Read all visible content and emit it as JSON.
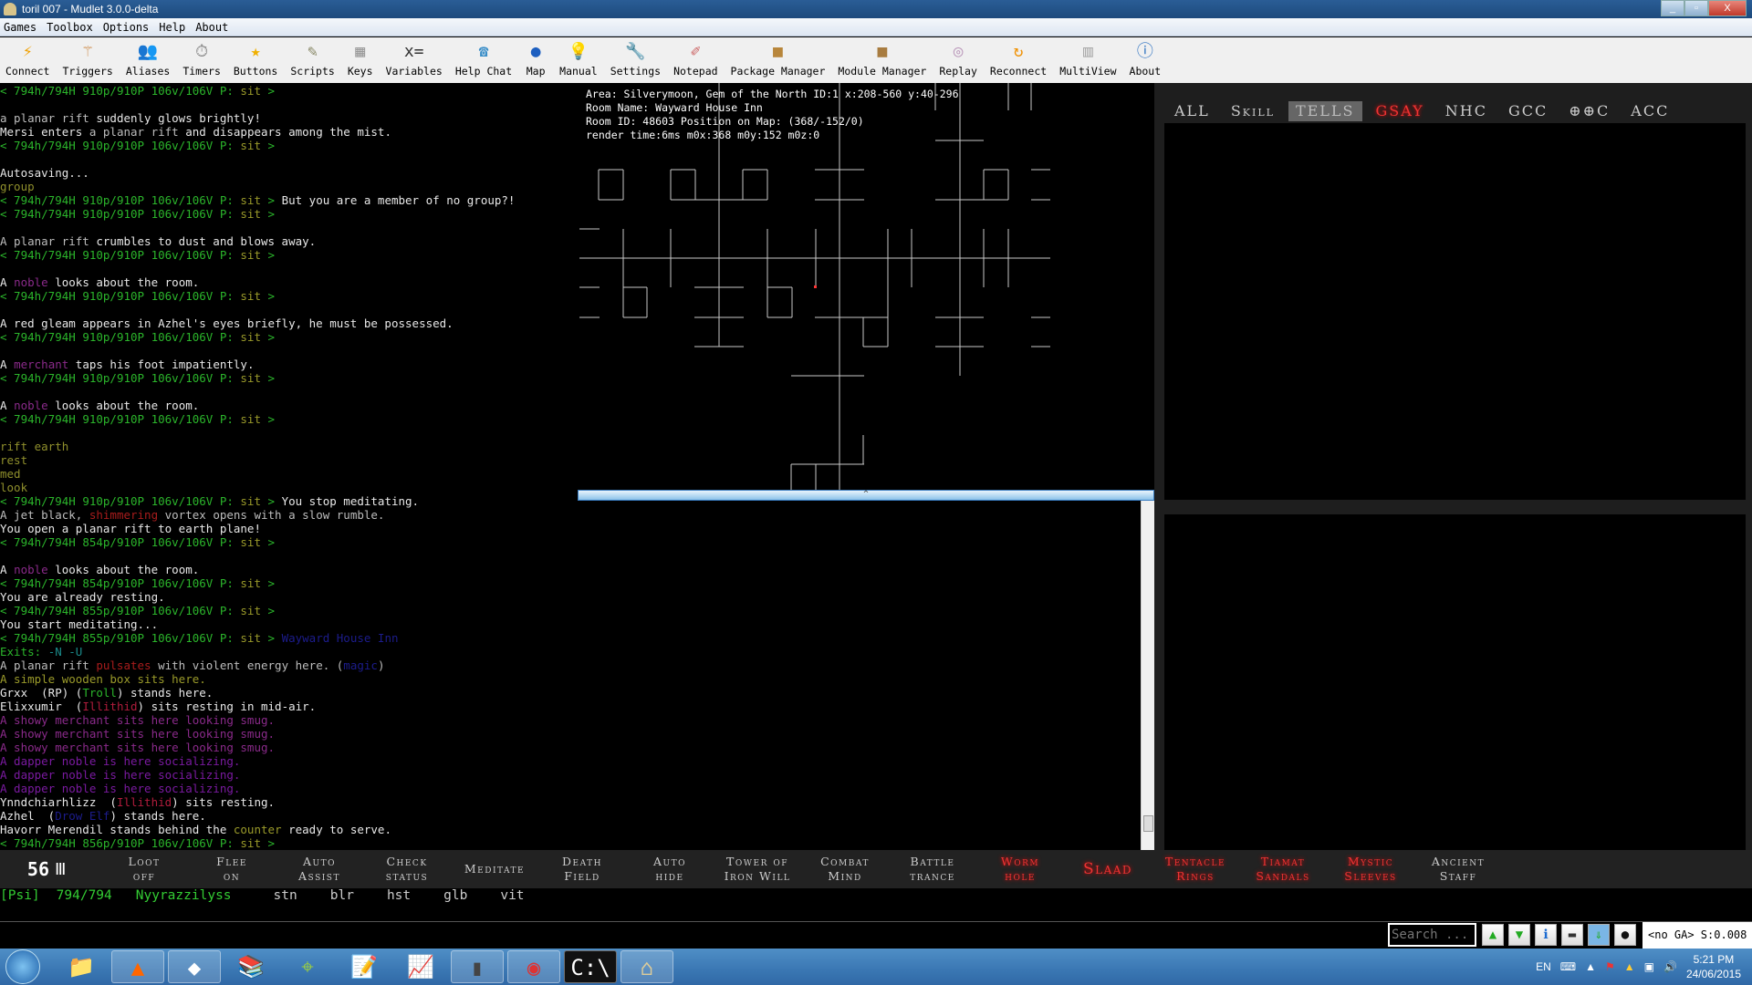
{
  "window": {
    "title": "toril 007 - Mudlet 3.0.0-delta"
  },
  "menu": [
    "Games",
    "Toolbox",
    "Options",
    "Help",
    "About"
  ],
  "toolbar": [
    {
      "label": "Connect",
      "icon": "connect-icon",
      "glyph": "⚡",
      "color": "#f0a000"
    },
    {
      "label": "Triggers",
      "icon": "triggers-icon",
      "glyph": "⚚",
      "color": "#c84"
    },
    {
      "label": "Aliases",
      "icon": "aliases-icon",
      "glyph": "👥",
      "color": "#a86"
    },
    {
      "label": "Timers",
      "icon": "timers-icon",
      "glyph": "⏱",
      "color": "#888"
    },
    {
      "label": "Buttons",
      "icon": "buttons-icon",
      "glyph": "★",
      "color": "#f0b000"
    },
    {
      "label": "Scripts",
      "icon": "scripts-icon",
      "glyph": "✎",
      "color": "#886"
    },
    {
      "label": "Keys",
      "icon": "keys-icon",
      "glyph": "▦",
      "color": "#999"
    },
    {
      "label": "Variables",
      "icon": "variables-icon",
      "glyph": "x=",
      "color": "#333"
    },
    {
      "label": "Help Chat",
      "icon": "help-chat-icon",
      "glyph": "☎",
      "color": "#3a8ec8"
    },
    {
      "label": "Map",
      "icon": "map-icon",
      "glyph": "●",
      "color": "#1d5fc0"
    },
    {
      "label": "Manual",
      "icon": "manual-icon",
      "glyph": "💡",
      "color": "#eec000"
    },
    {
      "label": "Settings",
      "icon": "settings-icon",
      "glyph": "🔧",
      "color": "#999"
    },
    {
      "label": "Notepad",
      "icon": "notepad-icon",
      "glyph": "✐",
      "color": "#c66"
    },
    {
      "label": "Package Manager",
      "icon": "package-manager-icon",
      "glyph": "■",
      "color": "#b8863b"
    },
    {
      "label": "Module Manager",
      "icon": "module-manager-icon",
      "glyph": "■",
      "color": "#a87c40"
    },
    {
      "label": "Replay",
      "icon": "replay-icon",
      "glyph": "◎",
      "color": "#b9b"
    },
    {
      "label": "Reconnect",
      "icon": "reconnect-icon",
      "glyph": "↻",
      "color": "#f09000"
    },
    {
      "label": "MultiView",
      "icon": "multiview-icon",
      "glyph": "▥",
      "color": "#aaa"
    },
    {
      "label": "About",
      "icon": "about-icon",
      "glyph": "ⓘ",
      "color": "#2a70c0"
    }
  ],
  "colors": {
    "prompt": "#2bb52b",
    "sit": "#9a9a2a",
    "gray": "#bdbdbd",
    "white": "#e8e8e8",
    "cmd": "#8f8f2c",
    "purple": "#8a2a8a",
    "red": "#a81c1c",
    "blue": "#1c1c8c",
    "teal": "#1a8a8a",
    "crimson": "#b01c3c",
    "violet": "#7a1aa0",
    "olive": "#9a9a2a"
  },
  "prompt": {
    "pre": "< 794h/794H ",
    "mid": " 106v/106V P: ",
    "sit": "sit",
    " end": " >",
    "end": " >"
  },
  "console": [
    {
      "p": "910p/910P",
      "s": []
    },
    {
      "s": []
    },
    {
      "s": [
        [
          "a planar rift",
          "gray"
        ],
        [
          " suddenly glows brightly!",
          "white"
        ]
      ]
    },
    {
      "s": [
        [
          "Mersi enters ",
          "white"
        ],
        [
          "a planar rift",
          "gray"
        ],
        [
          " and disappears among the mist.",
          "white"
        ]
      ]
    },
    {
      "p": "910p/910P",
      "s": []
    },
    {
      "s": []
    },
    {
      "s": [
        [
          "Autosaving...",
          "white"
        ]
      ]
    },
    {
      "s": [
        [
          "group",
          "cmd"
        ]
      ]
    },
    {
      "p": "910p/910P",
      "s": [
        [
          " But you are a member of no group?!",
          "white"
        ]
      ]
    },
    {
      "p": "910p/910P",
      "s": []
    },
    {
      "s": []
    },
    {
      "s": [
        [
          "A planar rift",
          "gray"
        ],
        [
          " crumbles to dust and blows away.",
          "white"
        ]
      ]
    },
    {
      "p": "910p/910P",
      "s": []
    },
    {
      "s": []
    },
    {
      "s": [
        [
          "A ",
          "white"
        ],
        [
          "noble",
          "purple"
        ],
        [
          " looks about the room.",
          "white"
        ]
      ]
    },
    {
      "p": "910p/910P",
      "s": []
    },
    {
      "s": []
    },
    {
      "s": [
        [
          "A red gleam appears in Azhel's eyes briefly, he must be possessed.",
          "white"
        ]
      ]
    },
    {
      "p": "910p/910P",
      "s": []
    },
    {
      "s": []
    },
    {
      "s": [
        [
          "A ",
          "white"
        ],
        [
          "merchant",
          "purple"
        ],
        [
          " taps his foot impatiently.",
          "white"
        ]
      ]
    },
    {
      "p": "910p/910P",
      "s": []
    },
    {
      "s": []
    },
    {
      "s": [
        [
          "A ",
          "white"
        ],
        [
          "noble",
          "purple"
        ],
        [
          " looks about the room.",
          "white"
        ]
      ]
    },
    {
      "p": "910p/910P",
      "s": []
    },
    {
      "s": []
    },
    {
      "s": [
        [
          "rift earth",
          "cmd"
        ]
      ]
    },
    {
      "s": [
        [
          "rest",
          "cmd"
        ]
      ]
    },
    {
      "s": [
        [
          "med",
          "cmd"
        ]
      ]
    },
    {
      "s": [
        [
          "look",
          "cmd"
        ]
      ]
    },
    {
      "p": "910p/910P",
      "s": [
        [
          " You stop meditating.",
          "white"
        ]
      ]
    },
    {
      "s": [
        [
          "A jet black, ",
          "gray"
        ],
        [
          "shimmering",
          "red"
        ],
        [
          " vortex opens with a slow rumble.",
          "gray"
        ]
      ]
    },
    {
      "s": [
        [
          "You open a planar rift to earth plane!",
          "white"
        ]
      ]
    },
    {
      "p": "854p/910P",
      "s": []
    },
    {
      "s": []
    },
    {
      "s": [
        [
          "A ",
          "white"
        ],
        [
          "noble",
          "purple"
        ],
        [
          " looks about the room.",
          "white"
        ]
      ]
    },
    {
      "p": "854p/910P",
      "s": []
    },
    {
      "s": [
        [
          "You are already resting.",
          "white"
        ]
      ]
    },
    {
      "p": "855p/910P",
      "s": []
    },
    {
      "s": [
        [
          "You start meditating...",
          "white"
        ]
      ]
    },
    {
      "p": "855p/910P",
      "s": [
        [
          " Wayward House Inn",
          "blue"
        ]
      ]
    },
    {
      "s": [
        [
          "Exits: ",
          "prompt"
        ],
        [
          "-N -U",
          "teal"
        ]
      ]
    },
    {
      "s": [
        [
          "A planar rift ",
          "gray"
        ],
        [
          "pulsates",
          "red"
        ],
        [
          " with violent energy here. (",
          "gray"
        ],
        [
          "magic",
          "blue"
        ],
        [
          ")",
          "gray"
        ]
      ]
    },
    {
      "s": [
        [
          "A simple wooden box sits here.",
          "olive"
        ]
      ]
    },
    {
      "s": [
        [
          "Grxx  (RP) (",
          "white"
        ],
        [
          "Troll",
          "prompt"
        ],
        [
          ") stands here.",
          "white"
        ]
      ]
    },
    {
      "s": [
        [
          "Elixxumir  (",
          "white"
        ],
        [
          "Illithid",
          "crimson"
        ],
        [
          ") sits resting in mid-air.",
          "white"
        ]
      ]
    },
    {
      "s": [
        [
          "A showy merchant sits here looking smug.",
          "purple"
        ]
      ]
    },
    {
      "s": [
        [
          "A showy merchant sits here looking smug.",
          "purple"
        ]
      ]
    },
    {
      "s": [
        [
          "A showy merchant sits here looking smug.",
          "purple"
        ]
      ]
    },
    {
      "s": [
        [
          "A dapper noble is here socializing.",
          "violet"
        ]
      ]
    },
    {
      "s": [
        [
          "A dapper noble is here socializing.",
          "violet"
        ]
      ]
    },
    {
      "s": [
        [
          "A dapper noble is here socializing.",
          "violet"
        ]
      ]
    },
    {
      "s": [
        [
          "Ynndchiarhlizz  (",
          "white"
        ],
        [
          "Illithid",
          "crimson"
        ],
        [
          ") sits resting.",
          "white"
        ]
      ]
    },
    {
      "s": [
        [
          "Azhel  (",
          "white"
        ],
        [
          "Drow Elf",
          "blue"
        ],
        [
          ") stands here.",
          "white"
        ]
      ]
    },
    {
      "s": [
        [
          "Havorr Merendil stands behind the ",
          "white"
        ],
        [
          "counter",
          "olive"
        ],
        [
          " ready to serve.",
          "white"
        ]
      ]
    },
    {
      "p": "856p/910P",
      "s": []
    }
  ],
  "map": {
    "area": "Area: Silverymoon, Gem of the North ID:1 x:208-560 y:40-296",
    "room_name": "Room Name: Wayward House Inn",
    "room_id": "Room ID: 48603 Position on Map: (368/-152/0)",
    "render": "render time:6ms m0x:368 m0y:152 m0z:0",
    "splitter": "^"
  },
  "chat_tabs": [
    {
      "label": "ALL",
      "style": ""
    },
    {
      "label": "Skill",
      "style": ""
    },
    {
      "label": "TELLS",
      "style": "active"
    },
    {
      "label": "GSAY",
      "style": "red"
    },
    {
      "label": "NHC",
      "style": ""
    },
    {
      "label": "GCC",
      "style": ""
    },
    {
      "label": "⊕⊕C",
      "style": ""
    },
    {
      "label": "ACC",
      "style": ""
    }
  ],
  "buttonbar": {
    "count": "56",
    "pillar": "Ⅲ",
    "buttons": [
      {
        "label": "Loot\noff",
        "style": ""
      },
      {
        "label": "Flee\non",
        "style": ""
      },
      {
        "label": "Auto\nAssist",
        "style": ""
      },
      {
        "label": "Check\nstatus",
        "style": ""
      },
      {
        "label": "Meditate",
        "style": ""
      },
      {
        "label": "Death\nField",
        "style": ""
      },
      {
        "label": "Auto\nhide",
        "style": ""
      },
      {
        "label": "Tower of\nIron Will",
        "style": ""
      },
      {
        "label": "Combat\nMind",
        "style": ""
      },
      {
        "label": "Battle\ntrance",
        "style": ""
      },
      {
        "label": "Worm\nhole",
        "style": "red"
      },
      {
        "label": "Slaad",
        "style": "red big"
      },
      {
        "label": "Tentacle\nRings",
        "style": "red"
      },
      {
        "label": "Tiamat\nSandals",
        "style": "red"
      },
      {
        "label": "Mystic\nSleeves",
        "style": "red"
      },
      {
        "label": "Ancient\nStaff",
        "style": ""
      }
    ]
  },
  "status": {
    "cls": "[Psi]",
    "hp": "794/794",
    "name": "Nyyrazzilyss",
    "spells": [
      "stn",
      "blr",
      "hst",
      "glb",
      "vit"
    ]
  },
  "command": {
    "value": "",
    "search_placeholder": "Search ...",
    "ga": "<no GA> S:0.008"
  },
  "taskbar": {
    "lang": "EN",
    "time": "5:21 PM",
    "date": "24/06/2015"
  }
}
